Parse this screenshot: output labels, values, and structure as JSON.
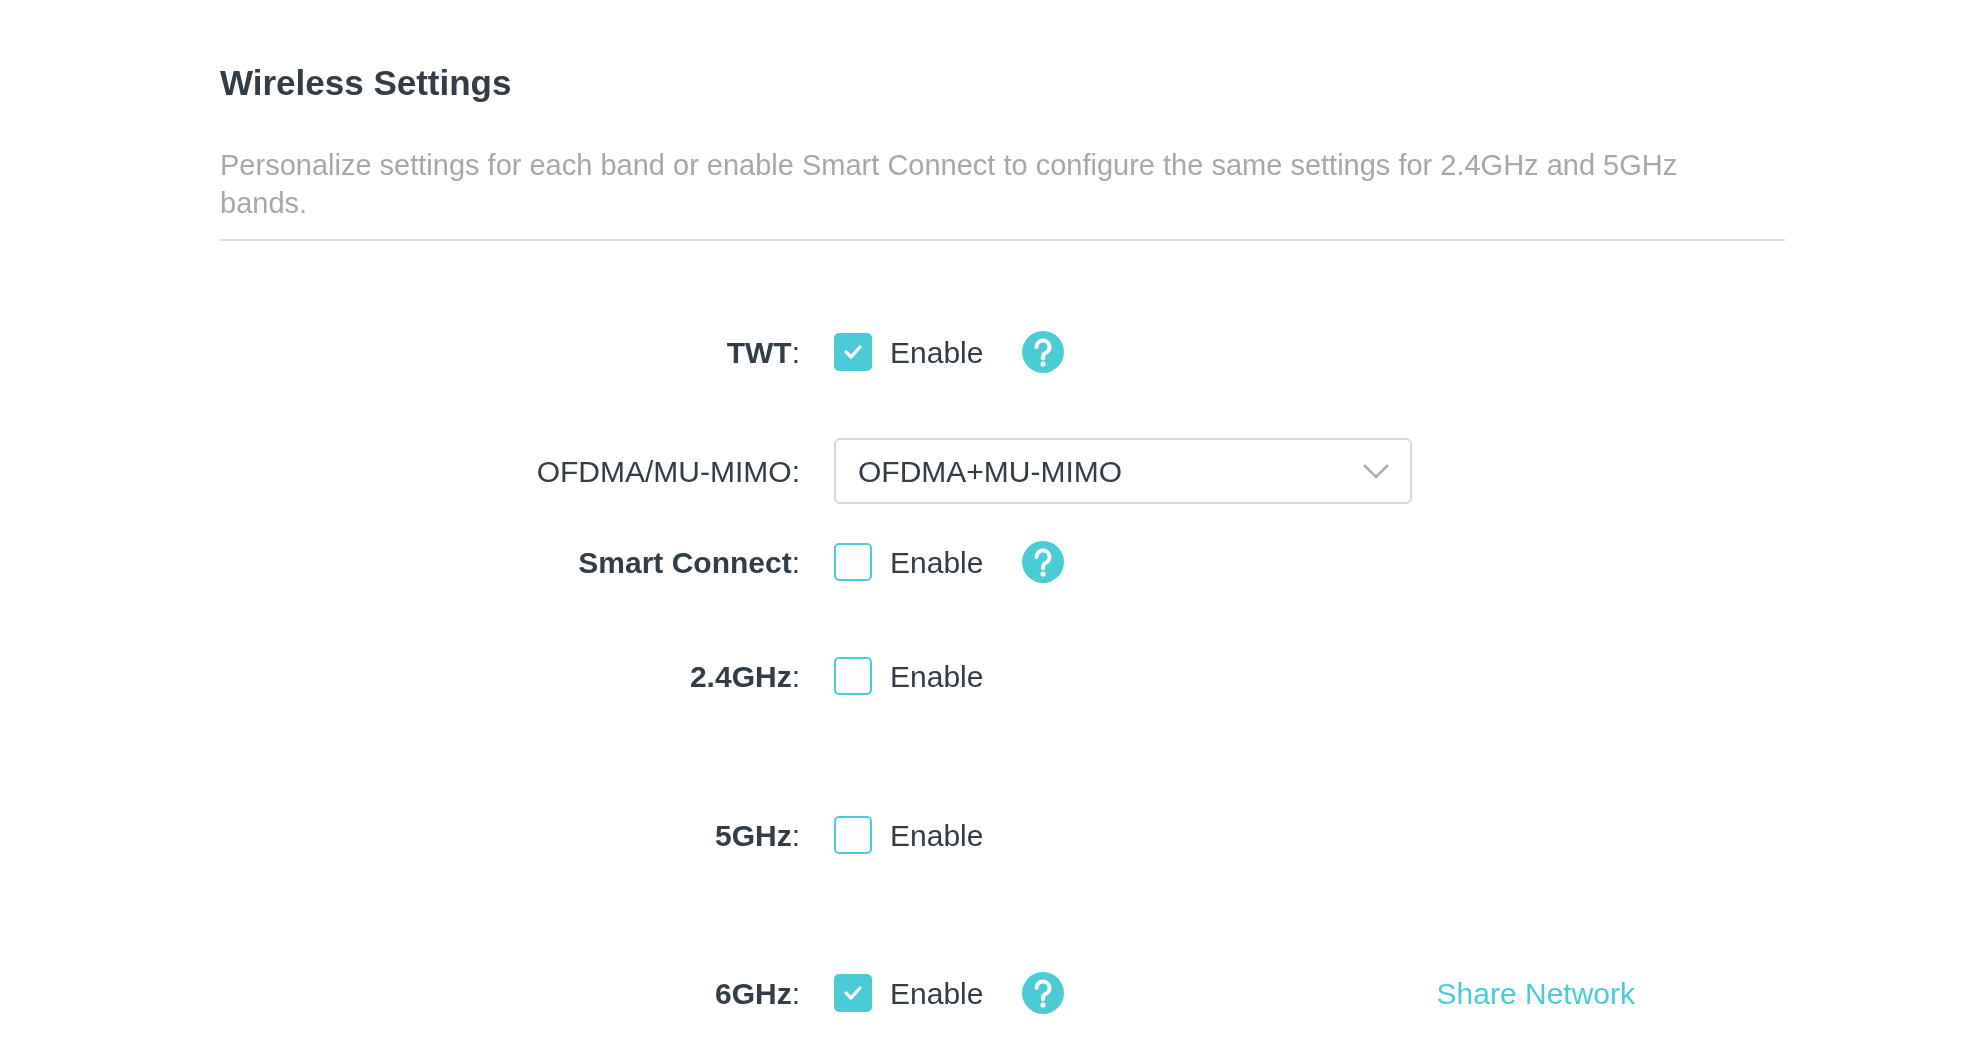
{
  "title": "Wireless Settings",
  "description": "Personalize settings for each band or enable Smart Connect to configure the same settings for 2.4GHz and 5GHz bands.",
  "rows": [
    {
      "kind": "checkbox",
      "label": "**TWT**:",
      "checked": true,
      "option": "Enable",
      "help": true
    },
    {
      "kind": "select",
      "label": "OFDMA/MU-MIMO:",
      "value": "OFDMA+MU-MIMO"
    },
    {
      "kind": "checkbox",
      "label": "**Smart Connect**:",
      "checked": false,
      "option": "Enable",
      "help": true
    },
    {
      "kind": "checkbox",
      "label": "**2.4GHz**:",
      "checked": false,
      "option": "Enable",
      "help": false
    },
    {
      "kind": "checkbox",
      "label": "**5GHz**:",
      "checked": false,
      "option": "Enable",
      "help": false
    },
    {
      "kind": "checkbox",
      "label": "**6GHz**:",
      "checked": true,
      "option": "Enable",
      "help": true,
      "link": "Share Network"
    }
  ]
}
